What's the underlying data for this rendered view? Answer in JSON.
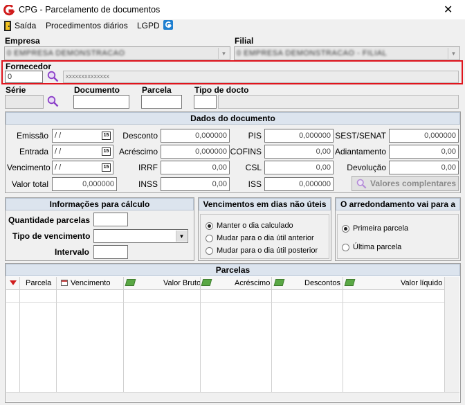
{
  "window": {
    "title": "CPG - Parcelamento de documentos",
    "close_glyph": "✕"
  },
  "menu": {
    "items": [
      "Saída",
      "Procedimentos diários",
      "LGPD"
    ]
  },
  "empresa": {
    "label": "Empresa",
    "value": "0 EMPRESA DEMONSTRACAO"
  },
  "filial": {
    "label": "Filial",
    "value": "0 EMPRESA DEMONSTRACAO - FILIAL"
  },
  "fornecedor": {
    "label": "Fornecedor",
    "code": "0",
    "name": "xxxxxxxxxxxxxx"
  },
  "serie": {
    "label": "Série"
  },
  "documento": {
    "label": "Documento"
  },
  "parcela": {
    "label": "Parcela"
  },
  "tipo_docto": {
    "label": "Tipo de docto"
  },
  "dados": {
    "title": "Dados do documento",
    "emissao": {
      "label": "Emissão",
      "value": " /  /"
    },
    "entrada": {
      "label": "Entrada",
      "value": " /  /"
    },
    "vencimento": {
      "label": "Vencimento",
      "value": " /  /"
    },
    "valor_total": {
      "label": "Valor total",
      "value": "0,000000"
    },
    "desconto": {
      "label": "Desconto",
      "value": "0,000000"
    },
    "acrescimo": {
      "label": "Acréscimo",
      "value": "0,000000"
    },
    "irrf": {
      "label": "IRRF",
      "value": "0,00"
    },
    "inss": {
      "label": "INSS",
      "value": "0,00"
    },
    "pis": {
      "label": "PIS",
      "value": "0,000000"
    },
    "cofins": {
      "label": "COFINS",
      "value": "0,00"
    },
    "csl": {
      "label": "CSL",
      "value": "0,00"
    },
    "iss": {
      "label": "ISS",
      "value": "0,000000"
    },
    "sest_senat": {
      "label": "SEST/SENAT",
      "value": "0,000000"
    },
    "adiantamento": {
      "label": "Adiantamento",
      "value": "0,00"
    },
    "devolucao": {
      "label": "Devolução",
      "value": "0,00"
    },
    "valores_btn": "Valores complentares",
    "cal_glyph": "15"
  },
  "calculo": {
    "title": "Informações para cálculo",
    "quantidade": "Quantidade parcelas",
    "tipo_venc": "Tipo de vencimento",
    "intervalo": "Intervalo"
  },
  "vencimentos": {
    "title": "Vencimentos em dias não úteis",
    "options": [
      "Manter o dia calculado",
      "Mudar para o dia útil anterior",
      "Mudar para o dia útil posterior"
    ]
  },
  "arredondamento": {
    "title": "O arredondamento vai para a",
    "options": [
      "Primeira parcela",
      "Última parcela"
    ]
  },
  "parcelas": {
    "title": "Parcelas",
    "columns": [
      "Parcela",
      "Vencimento",
      "Valor Bruto",
      "Acréscimo",
      "Descontos",
      "Valor líquido"
    ]
  },
  "colors": {
    "highlight": "#e0141c",
    "section_bg": "#dce4ee",
    "accent_red": "#d01c1c"
  }
}
